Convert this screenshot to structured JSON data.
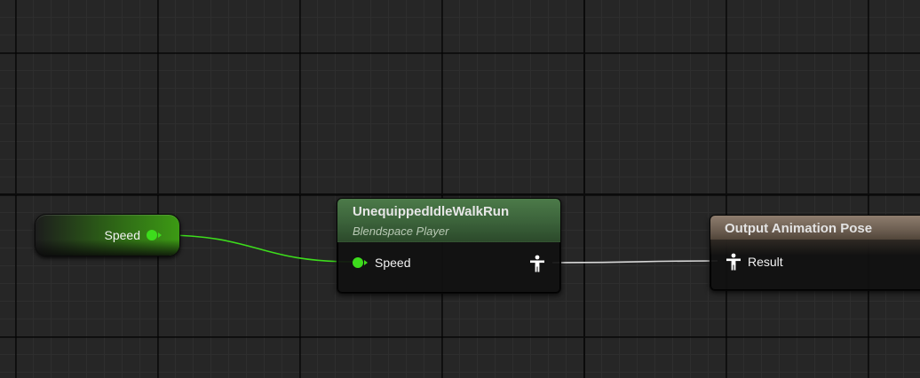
{
  "graph": {
    "wire_colors": {
      "float": "#3ddc1c",
      "pose": "#d8d8d8"
    }
  },
  "variable_node": {
    "pin_label": "Speed",
    "color": "#3ddc1c"
  },
  "blendspace_node": {
    "title": "UnequippedIdleWalkRun",
    "subtitle": "Blendspace Player",
    "input_pin_label": "Speed",
    "output_pin_icon": "pose-icon",
    "header_color": "#4c7a49"
  },
  "output_node": {
    "title": "Output Animation Pose",
    "input_pin_label": "Result",
    "input_pin_icon": "pose-icon",
    "header_color": "#8e7d6e"
  }
}
